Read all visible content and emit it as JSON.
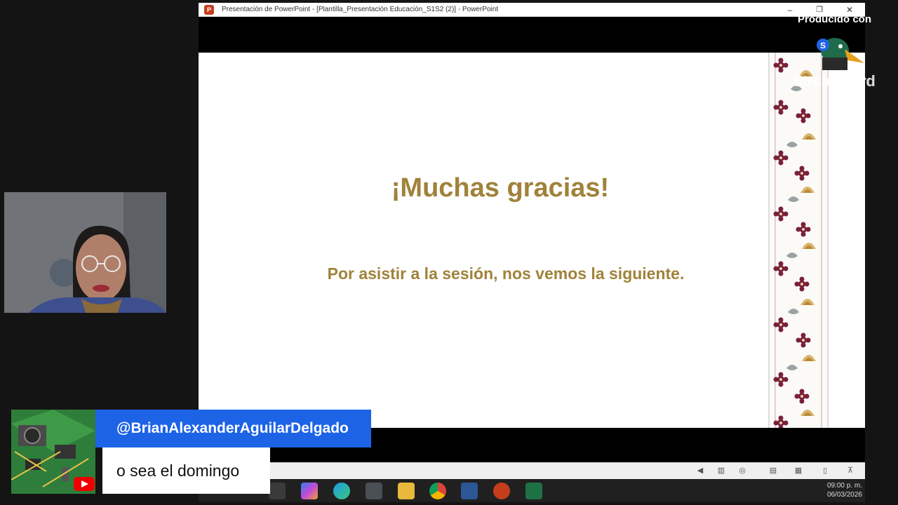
{
  "window": {
    "title": "Presentación de PowerPoint - [Plantilla_Presentación Educación_S1S2 (2)] - PowerPoint",
    "app_icon_letter": "P",
    "minimize": "–",
    "maximize": "❐",
    "close": "✕"
  },
  "slide": {
    "title": "¡Muchas gracias!",
    "subtitle": "Por asistir a la sesión, nos vemos la siguiente.",
    "text_color": "#a0823a"
  },
  "status_bar": {
    "icons": [
      "slide-nav-icon",
      "normal-view-icon",
      "reading-view-icon",
      "outline-view-icon",
      "slide-sorter-icon",
      "reading-mode-icon",
      "slideshow-icon"
    ]
  },
  "taskbar": {
    "apps": [
      "task-view",
      "copilot",
      "edge",
      "calculator",
      "file-explorer",
      "chrome",
      "word",
      "powerpoint",
      "excel"
    ],
    "time": "09:00 p. m.",
    "date": "06/03/2026"
  },
  "watermark": {
    "produced_by": "Producido con",
    "brand": "StreamYard"
  },
  "comment": {
    "author": "@BrianAlexanderAguilarDelgado",
    "text": "o sea el domingo",
    "platform_icon": "youtube-icon"
  },
  "colors": {
    "comment_author_bg": "#1d63e6",
    "youtube_red": "#e00000",
    "powerpoint_orange": "#c43e1c"
  }
}
